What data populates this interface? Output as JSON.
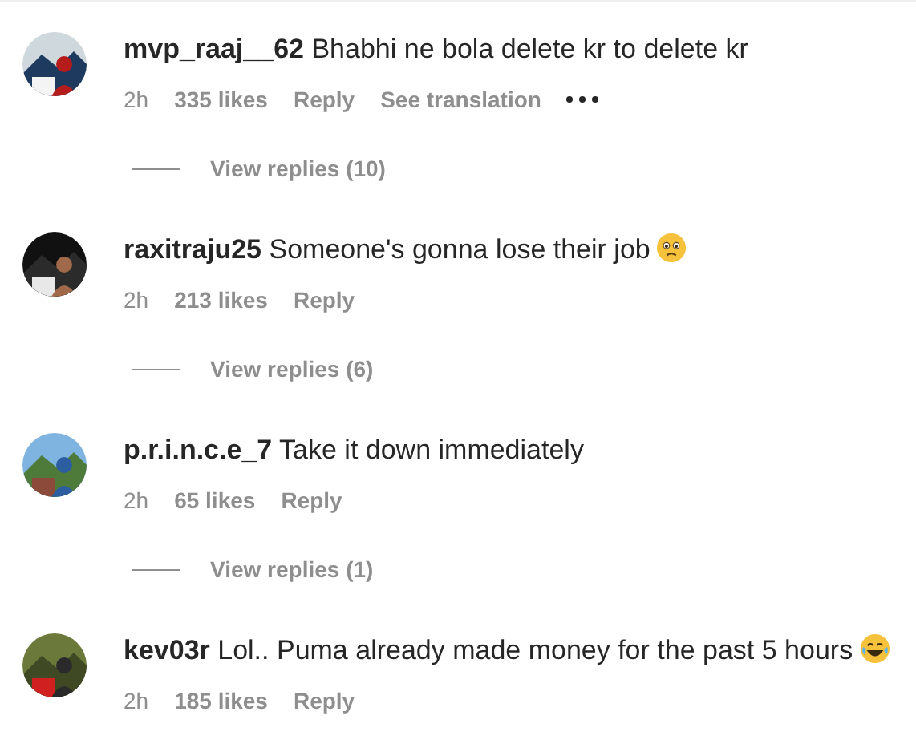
{
  "comments": [
    {
      "username": "mvp_raaj__62",
      "text": "Bhabhi ne bola delete kr to delete kr",
      "time": "2h",
      "likes": "335 likes",
      "reply": "Reply",
      "translate": "See translation",
      "more": true,
      "view_replies": "View replies (10)"
    },
    {
      "username": "raxitraju25",
      "text": "Someone's gonna lose their job",
      "kind": "sad",
      "time": "2h",
      "likes": "213 likes",
      "reply": "Reply",
      "more": false,
      "view_replies": "View replies (6)"
    },
    {
      "username": "p.r.i.n.c.e_7",
      "text": "Take it down immediately",
      "time": "2h",
      "likes": "65 likes",
      "reply": "Reply",
      "more": false,
      "view_replies": "View replies (1)"
    },
    {
      "username": "kev03r",
      "text": "Lol.. Puma already made money for the past 5 hours",
      "kind": "laughing",
      "time": "2h",
      "likes": "185 likes",
      "reply": "Reply",
      "more": false
    }
  ]
}
